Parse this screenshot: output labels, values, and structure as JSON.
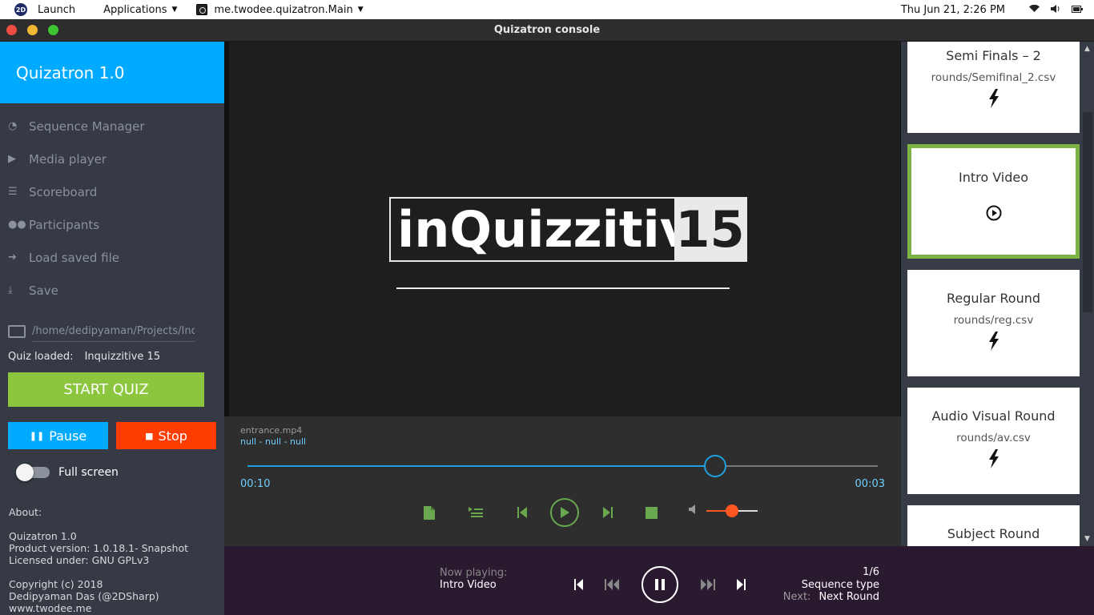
{
  "system_bar": {
    "logo": "2D",
    "launch": "Launch",
    "applications": "Applications",
    "active_app": "me.twodee.quizatron.Main",
    "clock": "Thu Jun 21,  2:26 PM",
    "icons": [
      "wifi-icon",
      "volume-icon",
      "battery-icon"
    ]
  },
  "window": {
    "title": "Quizatron console",
    "buttons": {
      "close": "#ed4c40",
      "minimize": "#f3b632",
      "maximize": "#3ec430"
    }
  },
  "sidebar": {
    "brand": "Quizatron 1.0",
    "nav": [
      {
        "label": "Sequence Manager",
        "icon": "dashboard-icon"
      },
      {
        "label": "Media player",
        "icon": "play-circle-icon"
      },
      {
        "label": "Scoreboard",
        "icon": "list-icon"
      },
      {
        "label": "Participants",
        "icon": "users-icon"
      },
      {
        "label": "Load saved file",
        "icon": "sign-in-icon"
      },
      {
        "label": "Save",
        "icon": "download-icon"
      }
    ],
    "path_value": "/home/dedipyaman/Projects/Inqu",
    "quiz_loaded_label": "Quiz loaded:",
    "quiz_loaded_value": "Inquizzitive 15",
    "start_label": "START QUIZ",
    "pause_label": "Pause",
    "stop_label": "Stop",
    "fullscreen_label": "Full screen",
    "fullscreen_on": false,
    "about": {
      "heading": "About:",
      "line1": "Quizatron 1.0",
      "line2": "Product version: 1.0.18.1- Snapshot",
      "line3": "Licensed under: GNU GPLv3",
      "line4": "Copyright (c) 2018",
      "line5": "Dedipyaman Das (@2DSharp)",
      "line6": "www.twodee.me"
    },
    "colors": {
      "brand": "#00aaff",
      "start": "#8cc63f",
      "pause": "#00aaff",
      "stop": "#ff3d00"
    }
  },
  "video": {
    "logo_text": "inQuizzitive",
    "logo_number": "15"
  },
  "player": {
    "file_name": "entrance.mp4",
    "meta": "null - null - null",
    "elapsed": "00:10",
    "remaining": "00:03",
    "progress_fraction": 0.742,
    "volume_fraction": 0.5
  },
  "sequence": {
    "items": [
      {
        "title": "Semi Finals – 2",
        "file": "rounds/Semifinal_2.csv",
        "icon": "bolt-icon"
      },
      {
        "title": "Intro Video",
        "file": "",
        "icon": "play-circle-icon",
        "active": true
      },
      {
        "title": "Regular Round",
        "file": "rounds/reg.csv",
        "icon": "bolt-icon"
      },
      {
        "title": "Audio Visual Round",
        "file": "rounds/av.csv",
        "icon": "bolt-icon"
      },
      {
        "title": "Subject Round",
        "file": "",
        "icon": "bolt-icon"
      }
    ],
    "active_color": "#7cb342"
  },
  "bottom": {
    "now_playing_label": "Now playing:",
    "now_playing_value": "Intro Video",
    "position": "1/6",
    "type": "Sequence type",
    "next_label": "Next:",
    "next_value": "Next Round"
  }
}
